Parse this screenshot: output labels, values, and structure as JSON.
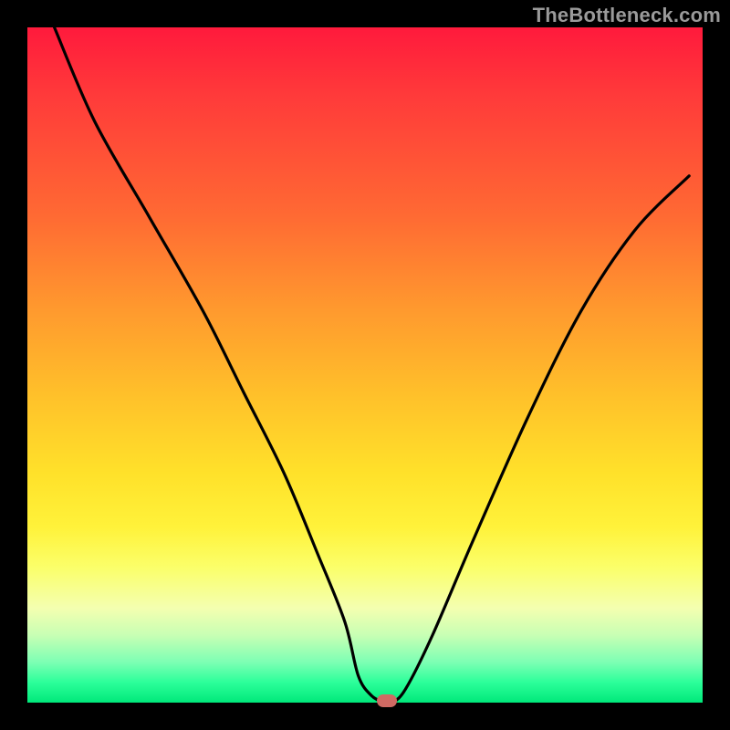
{
  "attribution": "TheBottleneck.com",
  "colors": {
    "frame": "#000000",
    "gradient_top": "#ff1a3c",
    "gradient_bottom": "#00e87a",
    "curve_stroke": "#000000",
    "marker": "#cf6a63",
    "attribution_text": "#9a9a9a"
  },
  "chart_data": {
    "type": "line",
    "title": "",
    "xlabel": "",
    "ylabel": "",
    "xlim": [
      0,
      100
    ],
    "ylim": [
      0,
      100
    ],
    "grid": false,
    "annotations": [
      "TheBottleneck.com"
    ],
    "series": [
      {
        "name": "bottleneck-curve",
        "x": [
          4,
          10,
          18,
          26,
          32,
          38,
          43,
          47,
          49,
          51,
          53,
          54,
          56,
          60,
          66,
          74,
          82,
          90,
          98
        ],
        "values": [
          100,
          86,
          72,
          58,
          46,
          34,
          22,
          12,
          4,
          1,
          0,
          0,
          2,
          10,
          24,
          42,
          58,
          70,
          78
        ]
      }
    ],
    "minimum_marker": {
      "x": 53.3,
      "y": 0
    },
    "description": "V-shaped bottleneck curve on a vertical red-to-green heat gradient. Left branch descends steeply from top-left; right branch rises toward mid-right. Minimum touches the bottom (green) band near x≈53 with a small rounded marker."
  }
}
